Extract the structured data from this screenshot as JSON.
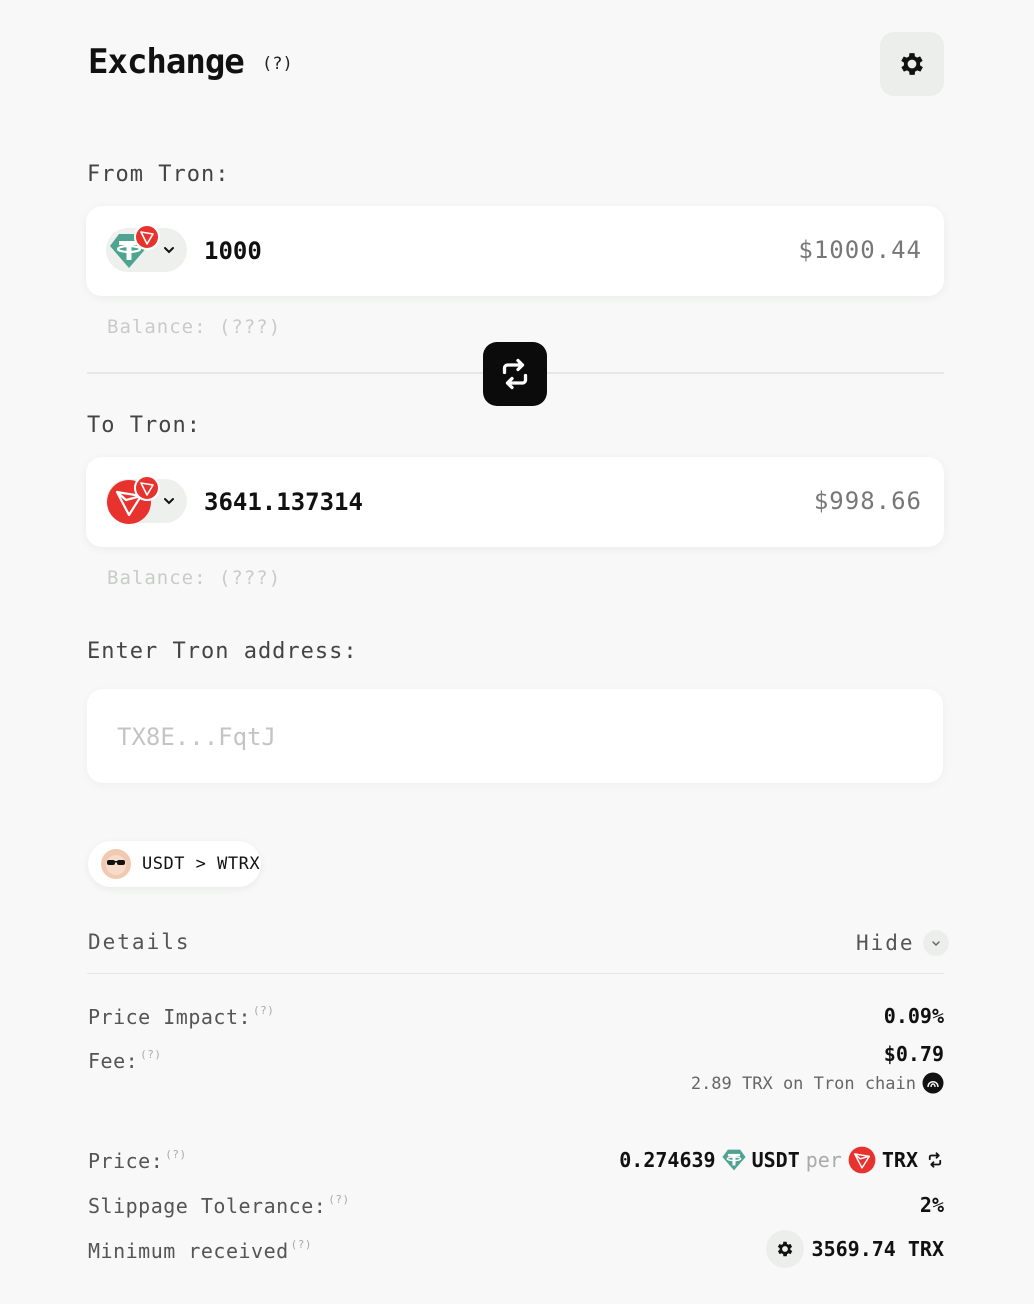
{
  "header": {
    "title": "Exchange",
    "title_hint": "(?)"
  },
  "from": {
    "label": "From Tron:",
    "token_icon": "usdt-icon",
    "chain_icon": "tron-icon",
    "amount": "1000",
    "usd_value": "$1000.44",
    "balance": "Balance: (???)"
  },
  "to": {
    "label": "To Tron:",
    "token_icon": "trx-icon",
    "chain_icon": "tron-icon",
    "amount": "3641.137314",
    "usd_value": "$998.66",
    "balance": "Balance: (???)"
  },
  "address": {
    "label": "Enter Tron address:",
    "placeholder": "TX8E...FqtJ"
  },
  "route": {
    "text": "USDT > WTRX",
    "avatar_icon": "dex-avatar-icon"
  },
  "details": {
    "label": "Details",
    "toggle_label": "Hide",
    "price_impact": {
      "label": "Price Impact:",
      "hint": "(?)",
      "value": "0.09%"
    },
    "fee": {
      "label": "Fee:",
      "hint": "(?)",
      "value": "$0.79",
      "sub_value": "2.89 TRX on Tron chain"
    },
    "price": {
      "label": "Price:",
      "hint": "(?)",
      "value": "0.274639",
      "base": "USDT",
      "per": "per",
      "quote": "TRX"
    },
    "slippage": {
      "label": "Slippage Tolerance:",
      "hint": "(?)",
      "value": "2%"
    },
    "minimum": {
      "label": "Minimum received",
      "hint": "(?)",
      "value": "3569.74 TRX"
    }
  },
  "colors": {
    "tether_green": "#4fa391",
    "tron_red": "#e8322d",
    "accent_dark": "#0b0b0b",
    "background": "#f7f8f7"
  }
}
